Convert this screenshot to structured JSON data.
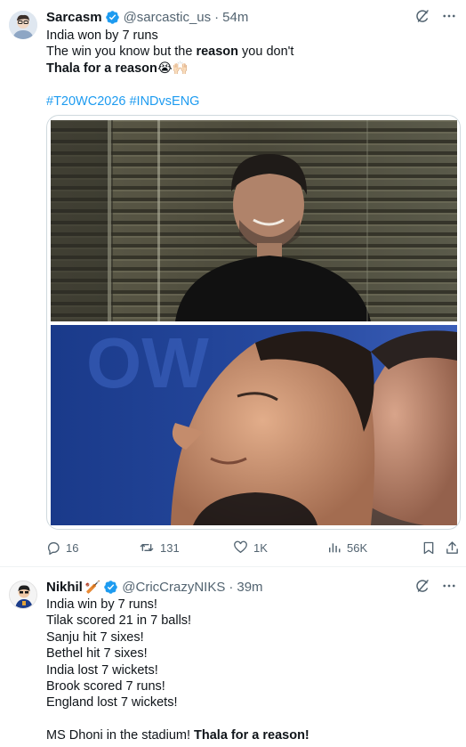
{
  "tweet1": {
    "display_name": "Sarcasm",
    "handle": "@sarcastic_us",
    "separator": "·",
    "time": "54m",
    "line1": "India won by 7 runs",
    "line2_pre": "The win you know but the ",
    "line2_bold": "reason",
    "line2_post": " you don't",
    "line3_bold": "Thala for a reason",
    "line3_emoji": "😭🙌🏻",
    "hashtags": "#T20WC2026 #INDvsENG",
    "media": {
      "top_image": "man-smiling-behind-glass-photo",
      "bottom_image": "two-men-looking-up-photo"
    },
    "actions": {
      "replies": "16",
      "reposts": "131",
      "likes": "1K",
      "views": "56K"
    }
  },
  "tweet2": {
    "display_name": "Nikhil",
    "name_emoji": "🏏",
    "handle": "@CricCrazyNIKS",
    "separator": "·",
    "time": "39m",
    "lines": [
      "India win by 7 runs!",
      "Tilak scored 21 in 7 balls!",
      "Sanju hit 7 sixes!",
      "Bethel hit 7 sixes!",
      "India lost 7 wickets!",
      "Brook scored 7 runs!",
      "England lost 7 wickets!"
    ],
    "final_pre": "MS Dhoni in the stadium! ",
    "final_bold": "Thala for a reason!"
  },
  "colors": {
    "text": "#0f1419",
    "secondary": "#536471",
    "link": "#1d9bf0",
    "verified": "#1d9bf0",
    "border": "#cfd9de"
  },
  "icons": {
    "verified": "verified-badge-icon",
    "grok": "grok-icon",
    "more": "more-icon",
    "reply": "reply-icon",
    "repost": "repost-icon",
    "like": "like-icon",
    "views": "views-icon",
    "bookmark": "bookmark-icon",
    "share": "share-icon"
  }
}
